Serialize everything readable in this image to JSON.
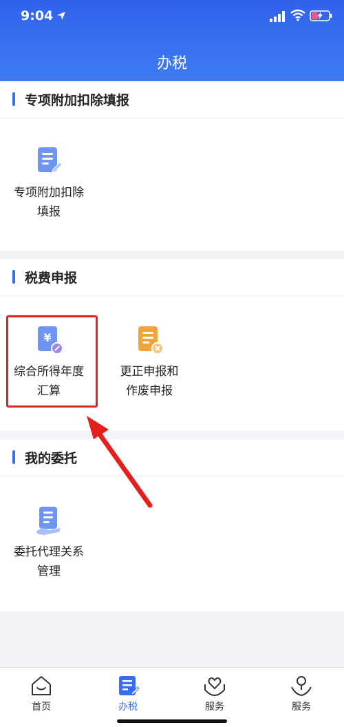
{
  "status_bar": {
    "time": "9:04",
    "icons": [
      "location-arrow-icon",
      "signal-icon",
      "wifi-icon",
      "battery-charging-icon"
    ]
  },
  "header": {
    "title": "办税"
  },
  "sections": [
    {
      "title": "专项附加扣除填报",
      "items": [
        {
          "label": "专项附加扣除\n填报",
          "icon": "document-edit-icon"
        }
      ]
    },
    {
      "title": "税费申报",
      "items": [
        {
          "label": "综合所得年度\n汇算",
          "icon": "yuan-document-icon",
          "highlighted": true
        },
        {
          "label": "更正申报和\n作废申报",
          "icon": "document-cancel-icon"
        }
      ]
    },
    {
      "title": "我的委托",
      "items": [
        {
          "label": "委托代理关系\n管理",
          "icon": "document-hand-icon"
        }
      ]
    }
  ],
  "tabbar": {
    "items": [
      {
        "label": "首页",
        "icon": "home-icon",
        "active": false
      },
      {
        "label": "办税",
        "icon": "tax-document-icon",
        "active": true
      },
      {
        "label": "服务",
        "icon": "heart-hand-icon",
        "active": false
      },
      {
        "label": "服务",
        "icon": "person-service-icon",
        "active": false
      }
    ]
  },
  "colors": {
    "header_start": "#2f62ec",
    "header_end": "#3f7cf3",
    "accent": "#3a6cf0",
    "highlight_red": "#e3201b",
    "icon_orange": "#f2a43a"
  }
}
